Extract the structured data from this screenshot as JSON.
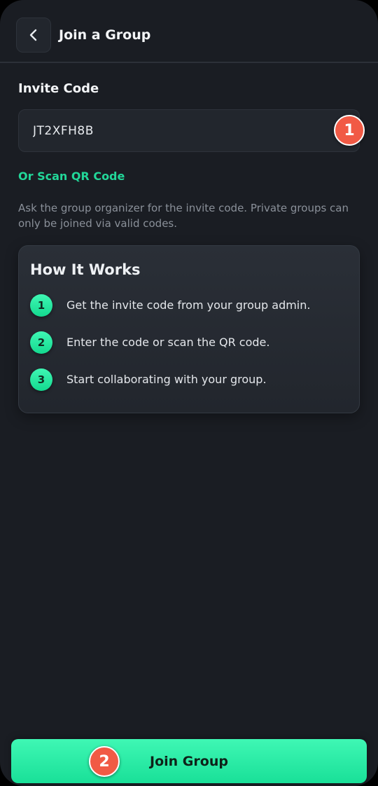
{
  "header": {
    "title": "Join a Group",
    "back_icon": "chevron-left-icon"
  },
  "invite": {
    "label": "Invite Code",
    "value": "JT2XFH8B",
    "scan_link": "Or Scan QR Code",
    "help": "Ask the group organizer for the invite code. Private groups can only be joined via valid codes."
  },
  "how_it_works": {
    "title": "How It Works",
    "steps": [
      {
        "number": "1",
        "text": "Get the invite code from your group admin."
      },
      {
        "number": "2",
        "text": "Enter the code or scan the QR code."
      },
      {
        "number": "3",
        "text": "Start collaborating with your group."
      }
    ]
  },
  "actions": {
    "join_label": "Join Group"
  },
  "markers": [
    "1",
    "2"
  ],
  "colors": {
    "background": "#1a1d23",
    "accent": "#22d799",
    "button": "#2af0a6",
    "marker": "#f15a45"
  }
}
